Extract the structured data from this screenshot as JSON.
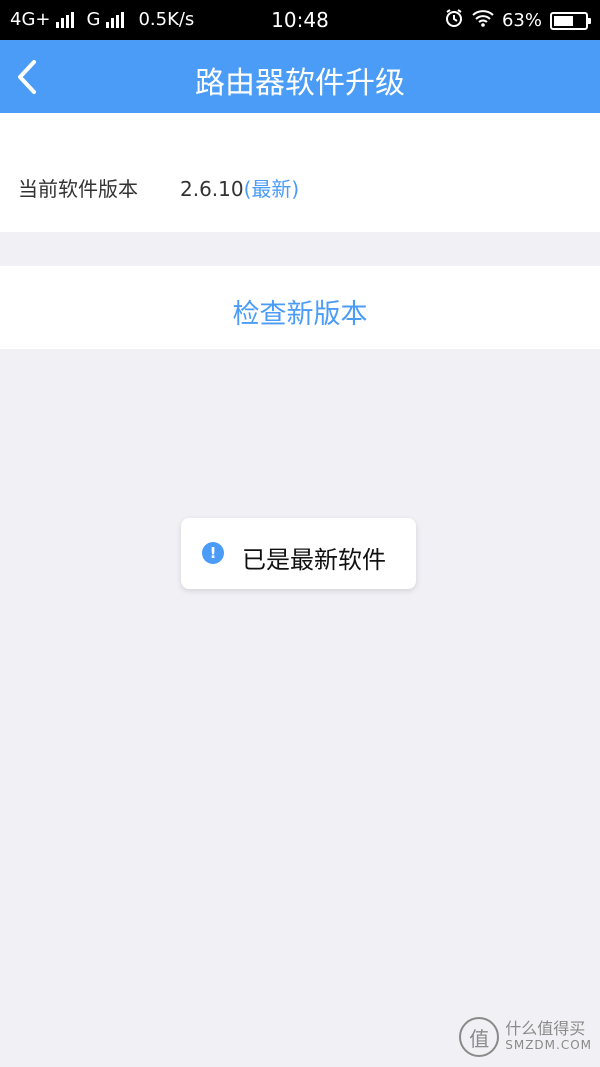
{
  "status_bar": {
    "network1": "4G+",
    "network2": "G",
    "speed": "0.5K/s",
    "time": "10:48",
    "battery": "63%",
    "battery_level": 0.63
  },
  "header": {
    "title": "路由器软件升级"
  },
  "version_section": {
    "label": "当前软件版本",
    "value": "2.6.10",
    "status": "(最新)"
  },
  "actions": {
    "check_label": "检查新版本"
  },
  "toast": {
    "message": "已是最新软件"
  },
  "watermark": {
    "logo": "值",
    "title": "什么值得买",
    "subtitle": "SMZDM.COM"
  },
  "colors": {
    "accent": "#4b9cf7",
    "background": "#f0f0f5"
  }
}
